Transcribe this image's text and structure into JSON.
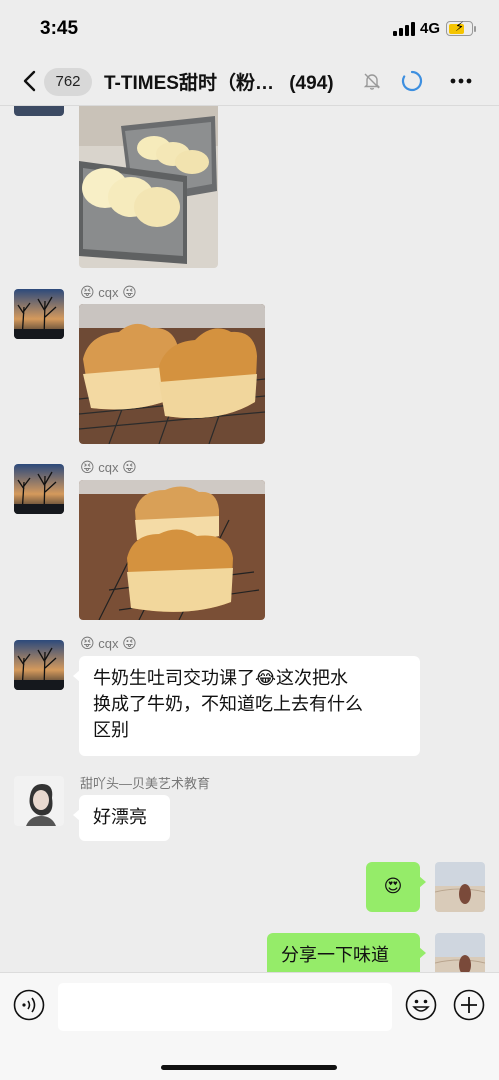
{
  "status": {
    "time": "3:45",
    "network": "4G"
  },
  "nav": {
    "unread_count": "762",
    "title": "T-TIMES甜时（粉…",
    "member_count": "(494)"
  },
  "messages": [
    {
      "type": "image",
      "desc": "two bread loaves in pans"
    },
    {
      "type": "image",
      "sender": "cqx",
      "sender_emoji_left": "😝",
      "sender_emoji_right": "😜"
    },
    {
      "type": "image",
      "sender": "cqx",
      "sender_emoji_left": "😝",
      "sender_emoji_right": "😜"
    },
    {
      "type": "text",
      "sender": "cqx",
      "sender_emoji_left": "😝",
      "sender_emoji_right": "😜",
      "line1": "牛奶生吐司交功课了😂这次把水",
      "line2": "换成了牛奶，不知道吃上去有什么",
      "line3": "区别"
    },
    {
      "type": "text",
      "sender": "甜吖头—贝美艺术教育",
      "text": "好漂亮"
    },
    {
      "type": "text",
      "self": true,
      "text": "😍"
    },
    {
      "type": "text",
      "self": true,
      "text": "分享一下味道"
    }
  ],
  "input": {
    "placeholder": ""
  },
  "colors": {
    "background": "#ededed",
    "self_bubble": "#95ec69",
    "other_bubble": "#ffffff"
  }
}
